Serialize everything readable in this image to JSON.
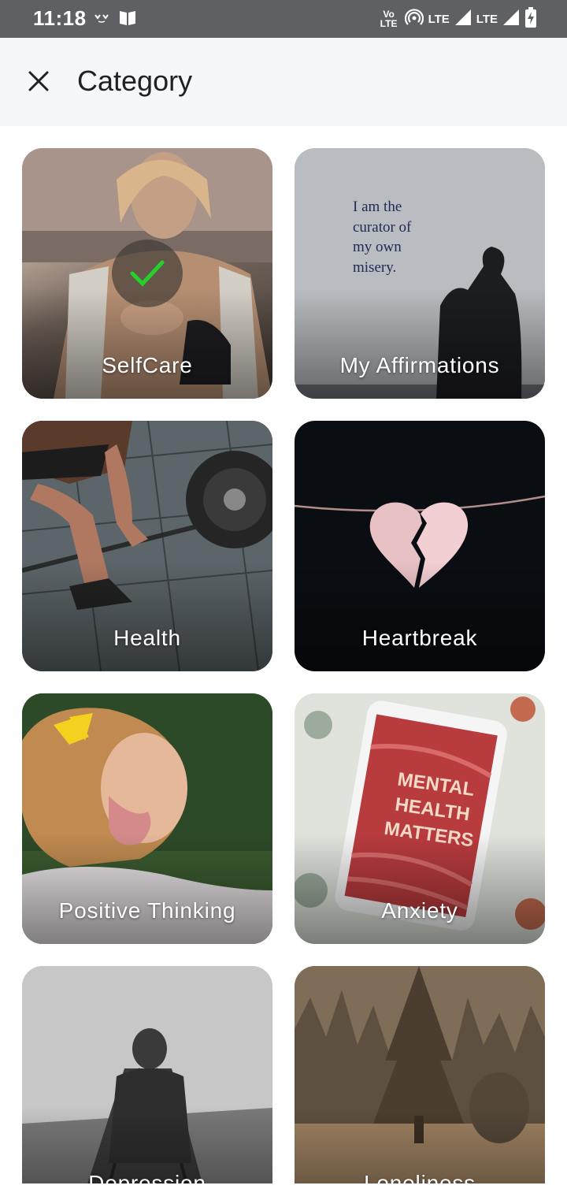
{
  "status_bar": {
    "time": "11:18",
    "network_label_1": "Vo LTE",
    "network_label_2": "LTE",
    "network_label_3": "LTE"
  },
  "app_bar": {
    "title": "Category"
  },
  "categories": [
    {
      "label": "SelfCare",
      "selected": true,
      "photo_text": ""
    },
    {
      "label": "My Affirmations",
      "selected": false,
      "photo_text": "I am the curator of my own misery."
    },
    {
      "label": "Health",
      "selected": false,
      "photo_text": ""
    },
    {
      "label": "Heartbreak",
      "selected": false,
      "photo_text": ""
    },
    {
      "label": "Positive Thinking",
      "selected": false,
      "photo_text": ""
    },
    {
      "label": "Anxiety",
      "selected": false,
      "photo_text": "MENTAL HEALTH MATTERS"
    },
    {
      "label": "Depression",
      "selected": false,
      "photo_text": ""
    },
    {
      "label": "Loneliness",
      "selected": false,
      "photo_text": ""
    }
  ],
  "colors": {
    "status_bar_bg": "#5f6064",
    "app_bar_bg": "#f6f7fb",
    "check_color": "#22d12a"
  }
}
